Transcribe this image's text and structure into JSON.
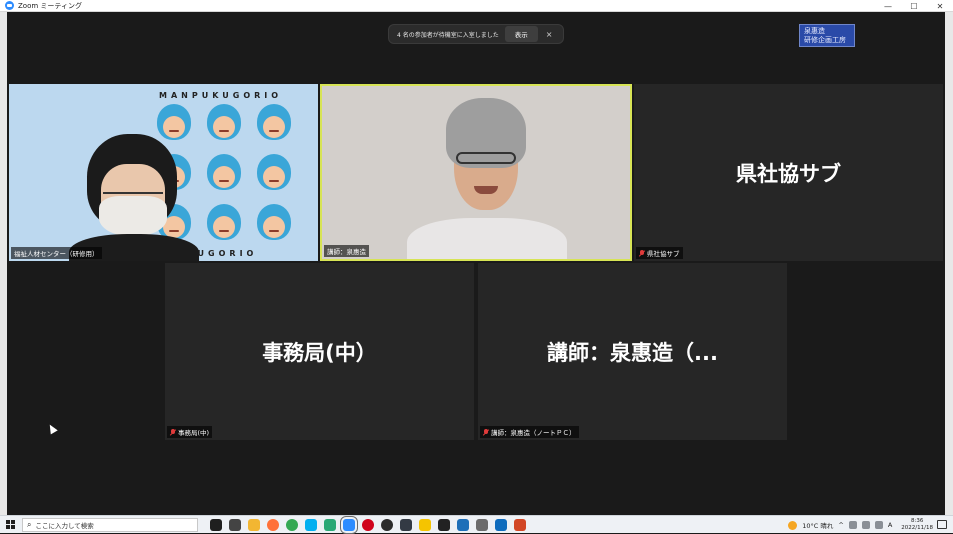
{
  "window": {
    "title": "Zoom ミーティング",
    "controls": {
      "minimize": "—",
      "maximize": "☐",
      "close": "✕"
    }
  },
  "notification": {
    "text": "4 名の参加者が待機室に入室しました",
    "button": "表示",
    "close": "×"
  },
  "corner_badge": {
    "line1": "泉惠造",
    "line2": "研修企画工房"
  },
  "participants": [
    {
      "name": "福祉人材センター（研修用）",
      "video": true,
      "background_text": "MANPUKUGORIO",
      "muted": false
    },
    {
      "name": "講師：泉惠造",
      "video": true,
      "active_speaker": true,
      "muted": false
    },
    {
      "name": "県社協サブ",
      "display": "県社協サブ",
      "video": false,
      "muted": true
    },
    {
      "name": "事務局(中)",
      "display": "事務局(中）",
      "video": false,
      "muted": true
    },
    {
      "name": "講師：泉惠造（ノートＰＣ）",
      "display": "講師：泉惠造（...",
      "video": false,
      "muted": true
    }
  ],
  "taskbar": {
    "search_placeholder": "ここに入力して検索",
    "apps": [
      {
        "icon": "task-view-icon",
        "color": "#1f1f1f"
      },
      {
        "icon": "multitask-icon",
        "color": "#444444"
      },
      {
        "icon": "file-explorer-icon",
        "color": "#f2b632"
      },
      {
        "icon": "firefox-icon",
        "color": "#ff7139"
      },
      {
        "icon": "chrome-icon",
        "color": "#34a853"
      },
      {
        "icon": "skype-icon",
        "color": "#00aff0"
      },
      {
        "icon": "edge-icon",
        "color": "#2aa876"
      },
      {
        "icon": "zoom-icon",
        "color": "#2d8cff"
      },
      {
        "icon": "record-icon",
        "color": "#d0021b"
      },
      {
        "icon": "obs-icon",
        "color": "#2b2b2b"
      },
      {
        "icon": "terminal-icon",
        "color": "#333a44"
      },
      {
        "icon": "notes-icon",
        "color": "#f5c400"
      },
      {
        "icon": "media-icon",
        "color": "#222222"
      },
      {
        "icon": "photos-icon",
        "color": "#1e6fb8"
      },
      {
        "icon": "camera-icon",
        "color": "#6b6b6b"
      },
      {
        "icon": "outlook-icon",
        "color": "#0f6cbd"
      },
      {
        "icon": "powerpoint-icon",
        "color": "#d24726"
      }
    ],
    "weather": "10°C 晴れ",
    "time": "8:36",
    "date": "2022/11/18",
    "ime": "A"
  }
}
